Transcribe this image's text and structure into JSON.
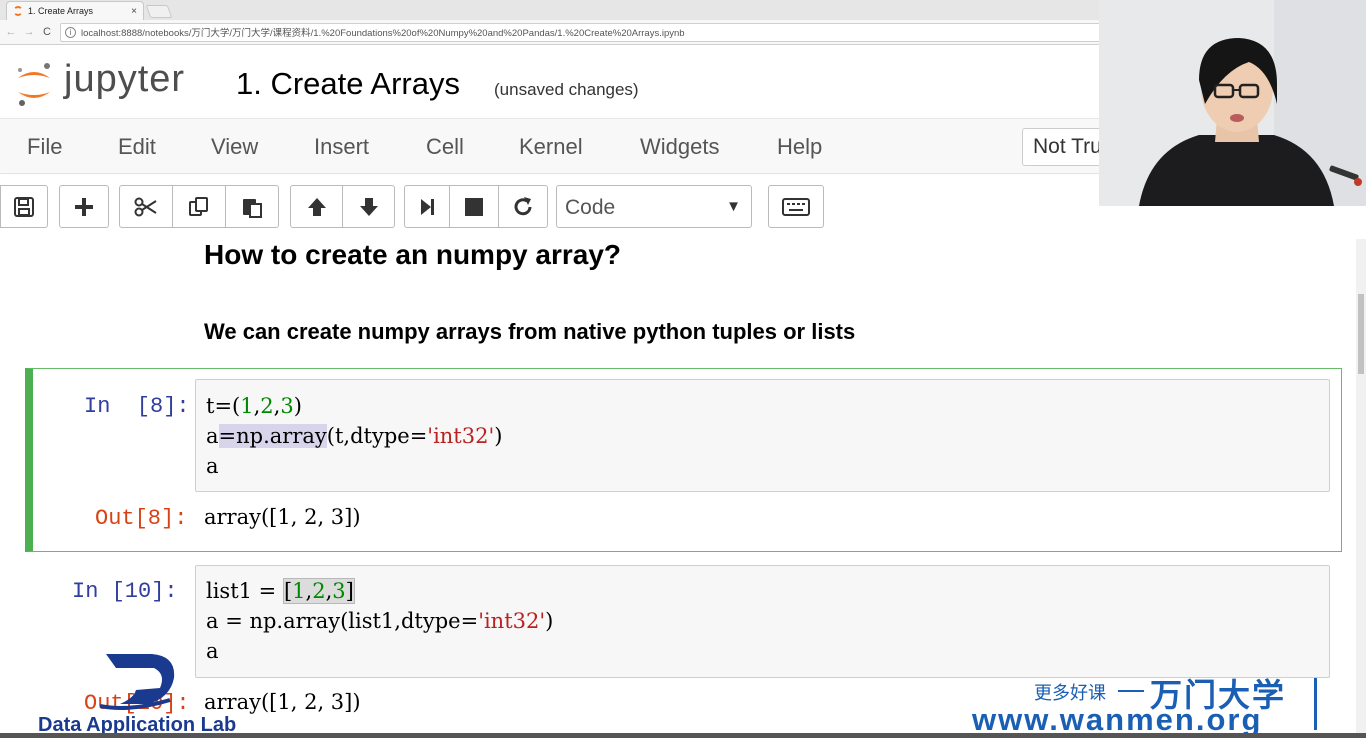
{
  "browser": {
    "tab_title": "1. Create Arrays",
    "tab_close": "×",
    "url": "localhost:8888/notebooks/万门大学/万门大学/课程资料/1.%20Foundations%20of%20Numpy%20and%20Pandas/1.%20Create%20Arrays.ipynb",
    "back": "←",
    "forward": "→",
    "reload": "C"
  },
  "header": {
    "logo_text": "jupyter",
    "title": "1. Create Arrays",
    "status": "(unsaved changes)"
  },
  "menu": {
    "items": [
      "File",
      "Edit",
      "View",
      "Insert",
      "Cell",
      "Kernel",
      "Widgets",
      "Help"
    ],
    "trust": "Not Trusted"
  },
  "toolbar": {
    "cell_type": "Code",
    "caret": "▼"
  },
  "notebook": {
    "heading": "How to create an numpy array?",
    "subheading": "We can create numpy arrays from native python tuples or lists",
    "cell1": {
      "in_prompt": "In  [8]:",
      "out_prompt": "Out[8]:",
      "line1_a": "t=(",
      "line1_n1": "1",
      "line1_c1": ",",
      "line1_n2": "2",
      "line1_c2": ",",
      "line1_n3": "3",
      "line1_close": ")",
      "line2_a": "a",
      "line2_hl": "=np.array",
      "line2_b": "(t,dtype=",
      "line2_str": "'int32'",
      "line2_close": ")",
      "line3": "a",
      "output": "array([1, 2, 3])"
    },
    "cell2": {
      "in_prompt": "In [10]:",
      "out_prompt": "Out[10]:",
      "line1_a": "list1 = ",
      "line1_hl_open": "[",
      "line1_n1": "1",
      "line1_c1": ",",
      "line1_n2": "2",
      "line1_c2": ",",
      "line1_n3": "3",
      "line1_hl_close": "]",
      "line2_a": "a = np.array(list1,dtype=",
      "line2_str": "'int32'",
      "line2_close": ")",
      "line3": "a",
      "output": "array([1, 2, 3])"
    }
  },
  "watermarks": {
    "dal": "Data Application Lab",
    "wanmen_top": "更多好课",
    "wanmen_brand": "万门大学",
    "wanmen_url": "www.wanmen.org"
  },
  "colors": {
    "jupyter_orange": "#f37726",
    "selected_cell": "#4caf50",
    "in_prompt": "#303f9f",
    "out_prompt": "#d84315",
    "string": "#ba2121",
    "number": "#008800",
    "watermark_blue": "#1a5fb4"
  }
}
